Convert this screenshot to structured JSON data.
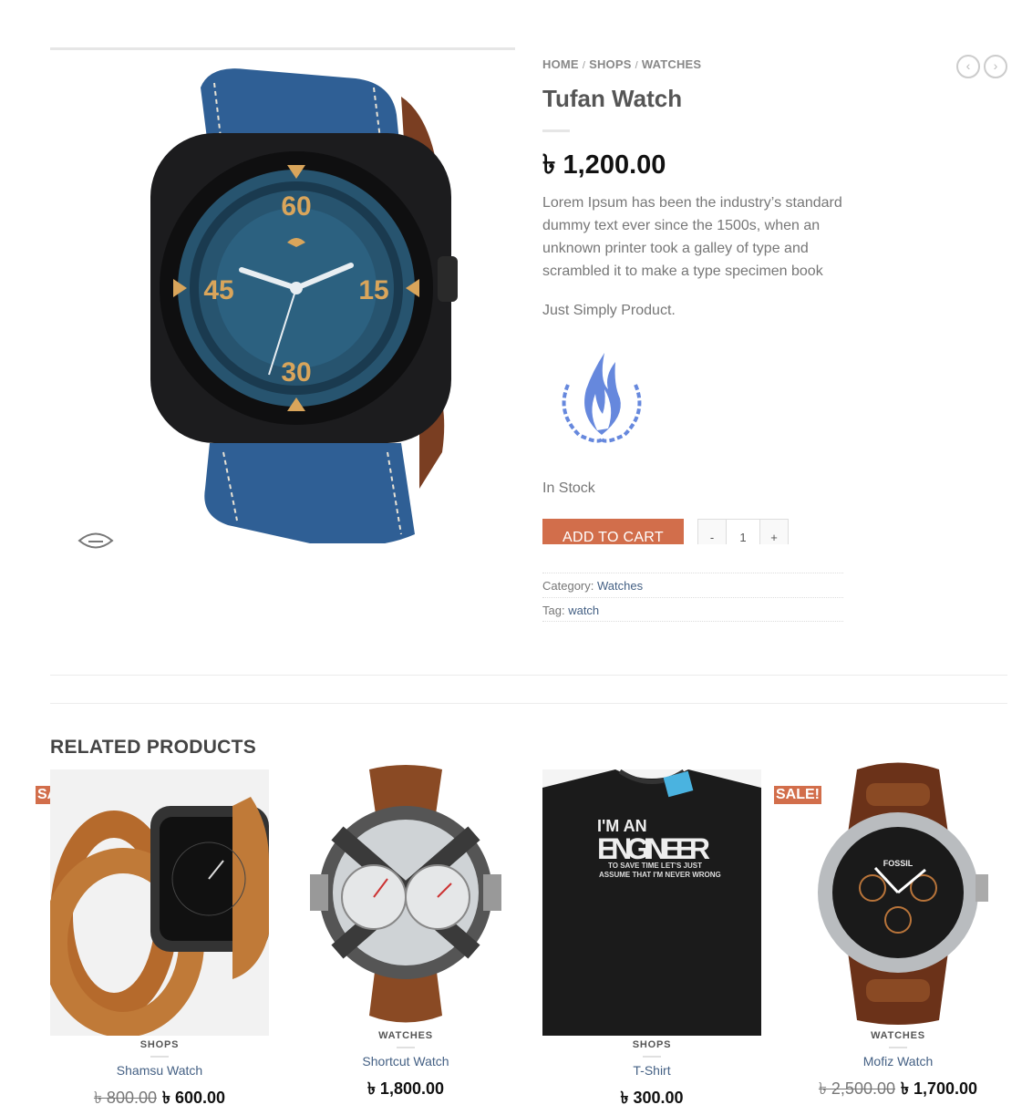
{
  "breadcrumb": {
    "home": "HOME",
    "sep1": "/",
    "shops": "SHOPS",
    "sep2": "/",
    "watches": "WATCHES"
  },
  "nav": {
    "prev": "‹",
    "next": "›"
  },
  "product": {
    "title": "Tufan Watch",
    "price": "৳ 1,200.00",
    "description": "Lorem Ipsum has been the industry’s standard dummy text ever since the 1500s, when an unknown printer took a galley of type and scrambled it to make a type specimen book",
    "short": "Just Simply Product.",
    "stock": "In Stock",
    "add_to_cart": "ADD TO CART",
    "qty_minus": "-",
    "qty_value": "1",
    "qty_plus": "+",
    "category_label": "Category:",
    "category": "Watches",
    "tag_label": "Tag:",
    "tag": "watch"
  },
  "related": {
    "title": "RELATED PRODUCTS",
    "items": [
      {
        "sale": "SALE!",
        "category": "SHOPS",
        "name": "Shamsu Watch",
        "old_price": "৳ 800.00",
        "price": "৳ 600.00"
      },
      {
        "sale": "",
        "category": "WATCHES",
        "name": "Shortcut Watch",
        "old_price": "",
        "price": "৳ 1,800.00"
      },
      {
        "sale": "",
        "category": "SHOPS",
        "name": "T-Shirt",
        "old_price": "",
        "price": "৳ 300.00"
      },
      {
        "sale": "SALE!",
        "category": "WATCHES",
        "name": "Mofiz Watch",
        "old_price": "৳ 2,500.00",
        "price": "৳ 1,700.00"
      }
    ]
  },
  "tshirt_text": {
    "line1": "I'M AN",
    "line2": "ENGINEER",
    "line3": "TO SAVE TIME LET'S JUST",
    "line4": "ASSUME THAT I'M NEVER WRONG"
  },
  "watch_dial": {
    "n60": "60",
    "n15": "15",
    "n30": "30",
    "n45": "45"
  },
  "brand_watch": {
    "fossil": "FOSSIL"
  },
  "colors": {
    "accent": "#d26e4b",
    "link": "#446084",
    "denim": "#2f5f95",
    "dial": "#27546f"
  }
}
